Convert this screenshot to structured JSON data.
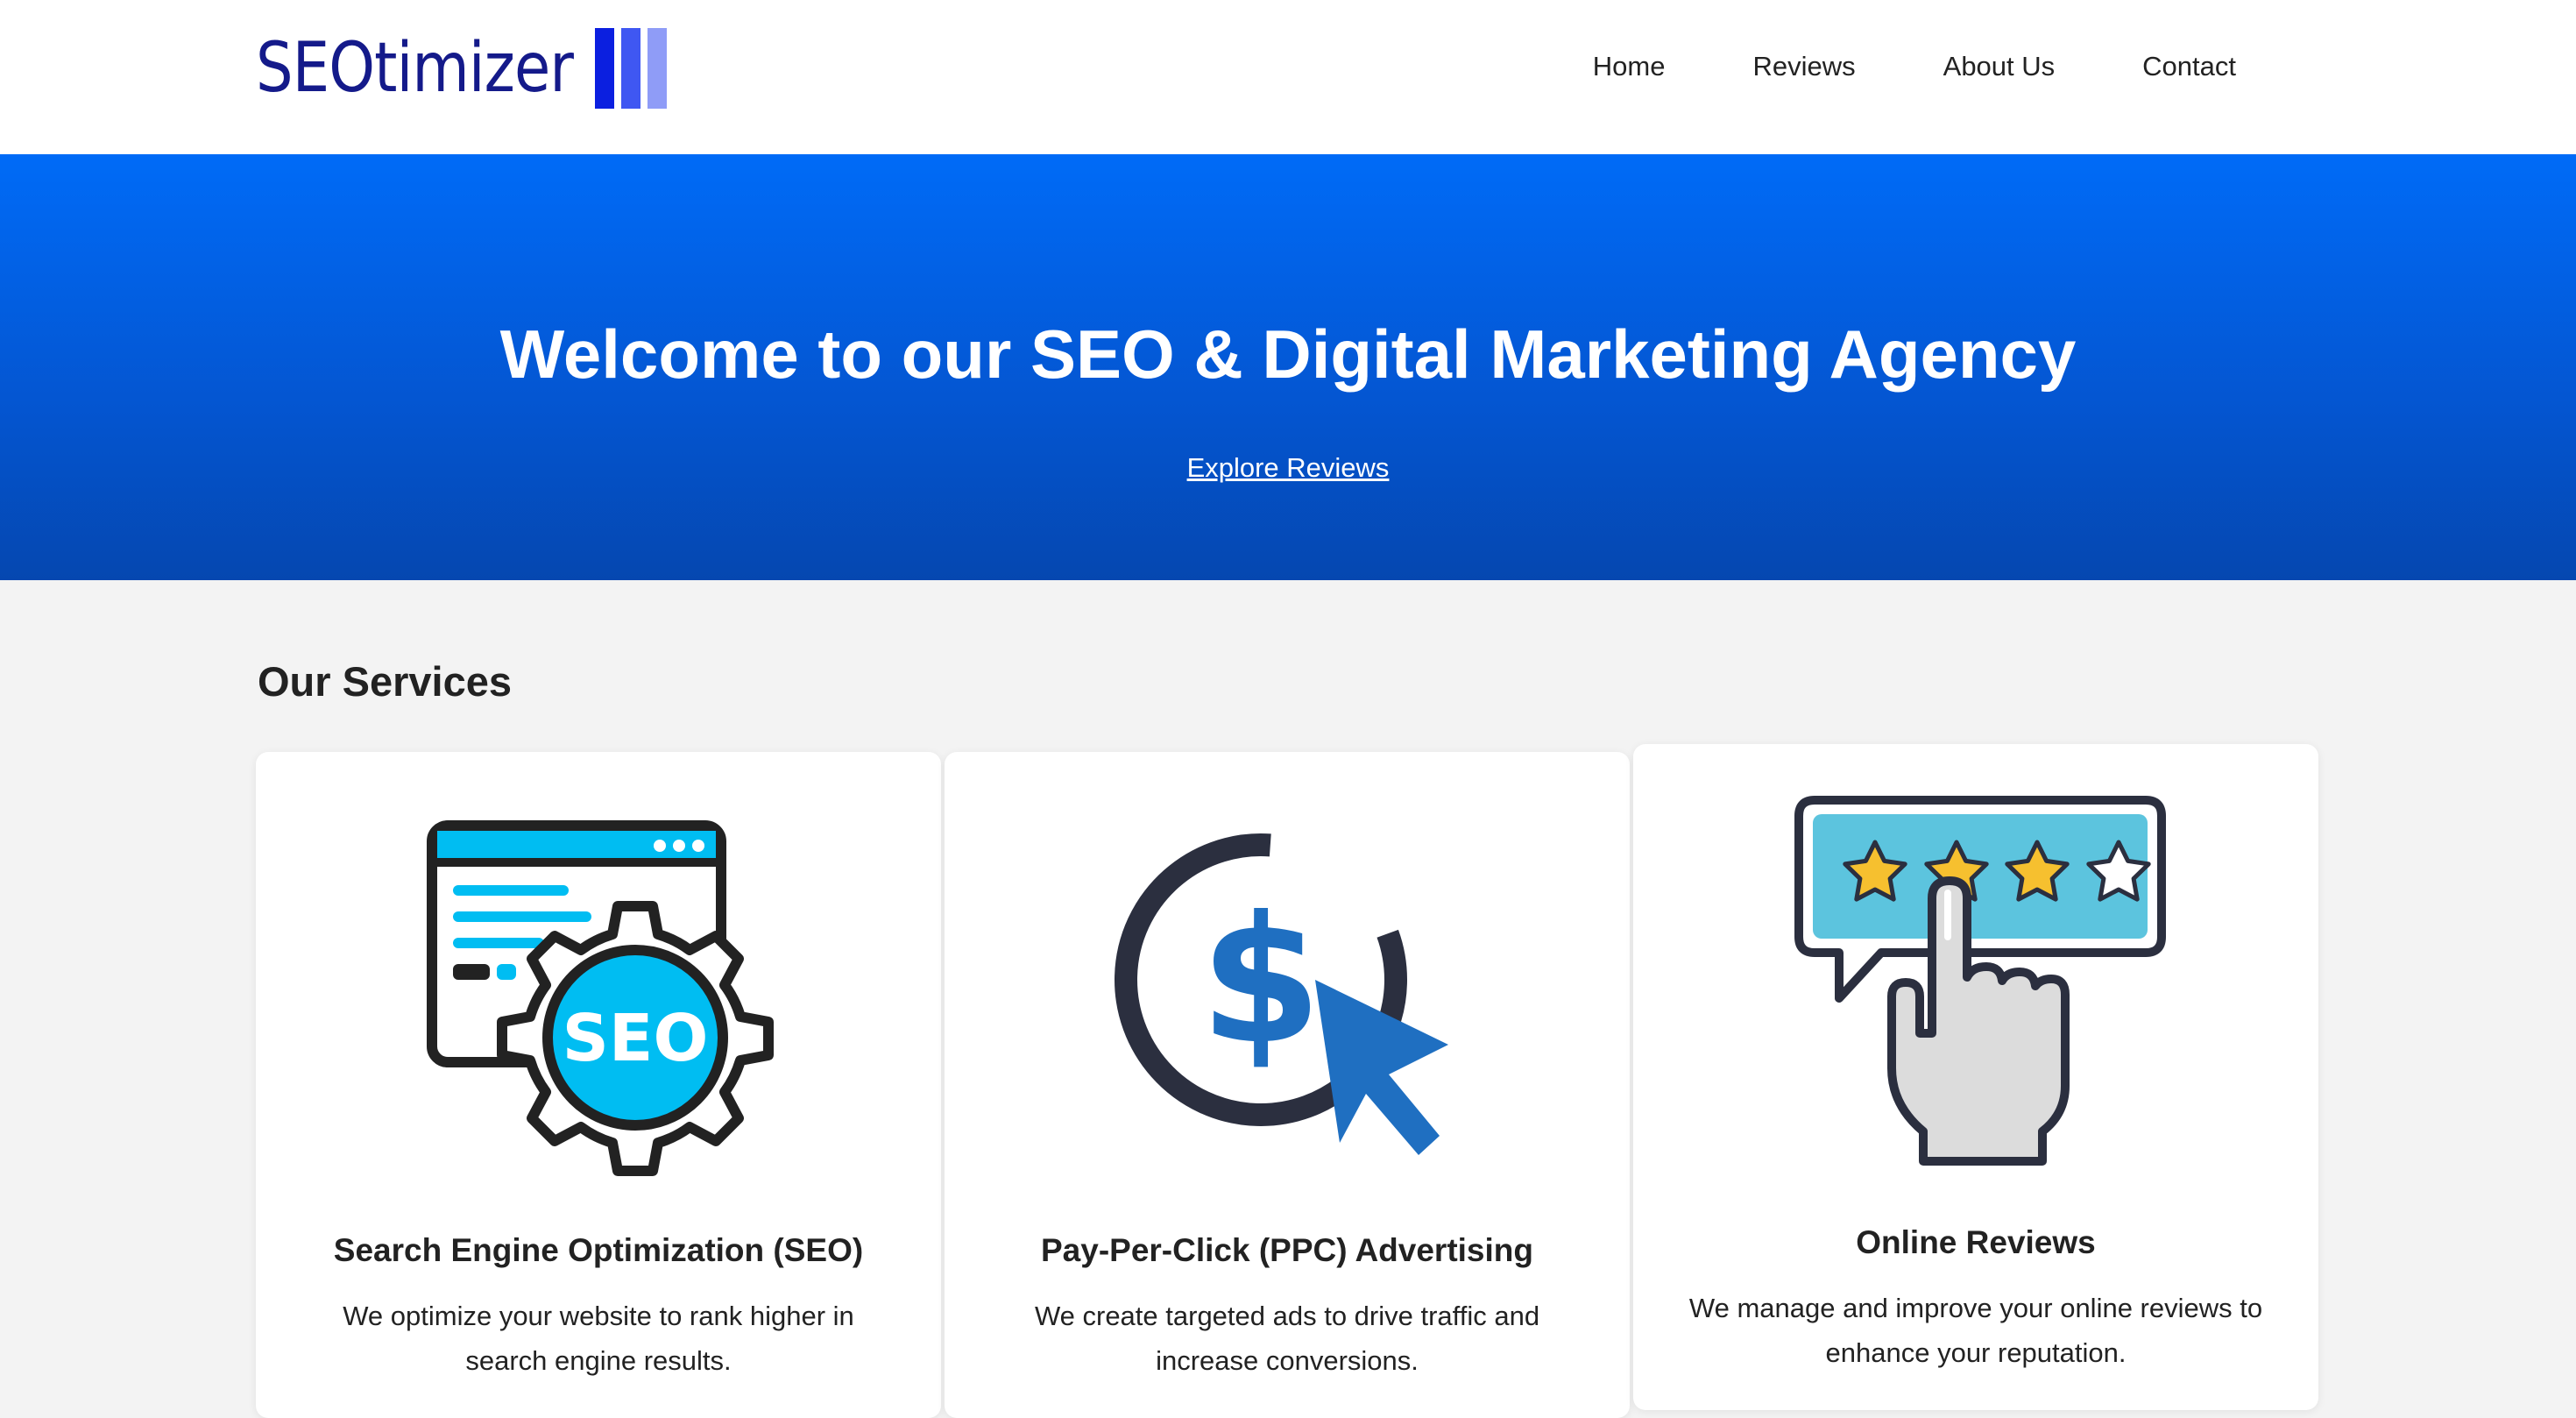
{
  "header": {
    "logo_text": "SEOtimizer",
    "logo_bar_colors": [
      "#0b1fe0",
      "#3f57f2",
      "#8f9cf7"
    ],
    "nav": [
      "Home",
      "Reviews",
      "About Us",
      "Contact"
    ]
  },
  "hero": {
    "title": "Welcome to our SEO & Digital Marketing Agency",
    "link": "Explore Reviews"
  },
  "services": {
    "title": "Our Services",
    "cards": [
      {
        "icon": "seo-gear-icon",
        "icon_badge": "SEO",
        "title": "Search Engine Optimization (SEO)",
        "description": "We optimize your website to rank higher in search engine results."
      },
      {
        "icon": "ppc-dollar-cursor-icon",
        "title": "Pay-Per-Click (PPC) Advertising",
        "description": "We create targeted ads to drive traffic and increase conversions."
      },
      {
        "icon": "review-stars-hand-icon",
        "title": "Online Reviews",
        "description": "We manage and improve your online reviews to enhance your reputation."
      }
    ]
  },
  "colors": {
    "brand": "#141a8a",
    "hero_top": "#006bf7",
    "hero_bottom": "#0547b0",
    "seo_cyan": "#00bdf2",
    "ppc_blue": "#1f6fc1",
    "review_teal": "#5cc4de",
    "star_yellow": "#f6c02f"
  }
}
